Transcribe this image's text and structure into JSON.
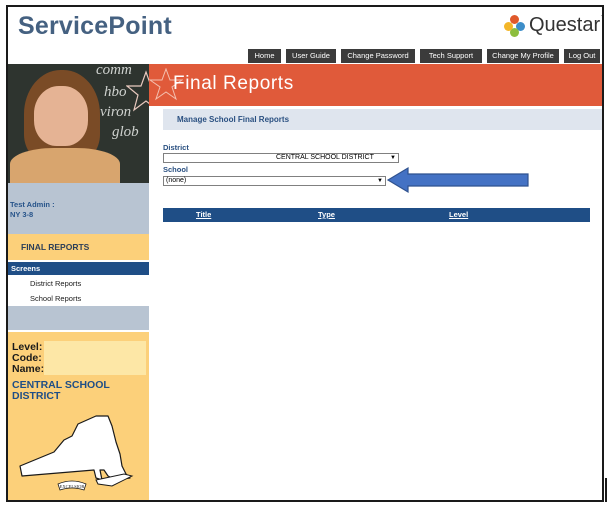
{
  "app": {
    "brand": "ServicePoint",
    "vendor": "Questar",
    "vendor_mark": "™"
  },
  "nav": {
    "items": [
      {
        "label": "Home"
      },
      {
        "label": "User Guide"
      },
      {
        "label": "Change Password"
      },
      {
        "label": "Tech Support"
      },
      {
        "label": "Change My Profile"
      },
      {
        "label": "Log Out"
      }
    ]
  },
  "user": {
    "line1": "Test Admin :",
    "line2": "NY 3-8"
  },
  "sidebar": {
    "section_title": "FINAL REPORTS",
    "screens_label": "Screens",
    "links": [
      {
        "label": "District Reports"
      },
      {
        "label": "School Reports"
      }
    ]
  },
  "info": {
    "level_label": "Level:",
    "code_label": "Code:",
    "name_label": "Name:",
    "district_line1": "CENTRAL SCHOOL",
    "district_line2": "DISTRICT",
    "map_caption": "EXCELSIOR"
  },
  "page": {
    "title": "Final Reports",
    "subtitle": "Manage School Final Reports"
  },
  "form": {
    "district_label": "District",
    "district_value": "CENTRAL SCHOOL DISTRICT",
    "school_label": "School",
    "school_value": "(none)"
  },
  "table": {
    "columns": [
      "Title",
      "Type",
      "Level"
    ]
  },
  "colors": {
    "accent_banner": "#e05a3a",
    "navy": "#1f4e86",
    "gold": "#fcd07a",
    "slate": "#b8c4d2"
  }
}
